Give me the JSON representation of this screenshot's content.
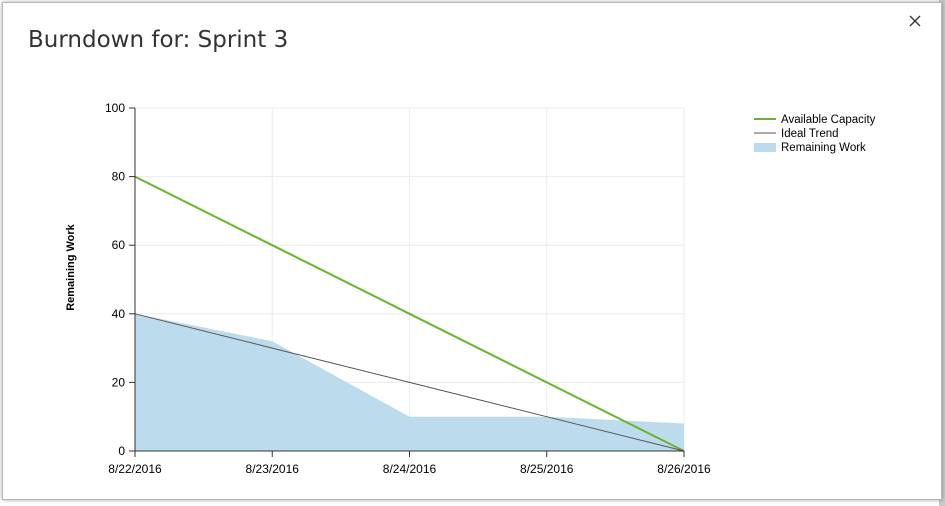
{
  "dialog": {
    "title": "Burndown for: Sprint 3",
    "close_icon": "close-icon"
  },
  "chart_data": {
    "type": "line",
    "title": "",
    "xlabel": "",
    "ylabel": "Remaining Work",
    "x": [
      "8/22/2016",
      "8/23/2016",
      "8/24/2016",
      "8/25/2016",
      "8/26/2016"
    ],
    "ylim": [
      0,
      100
    ],
    "yticks": [
      0,
      20,
      40,
      60,
      80,
      100
    ],
    "grid": true,
    "legend_position": "top-right",
    "series": [
      {
        "name": "Available Capacity",
        "kind": "line",
        "color": "#6bb32e",
        "values": [
          80,
          60,
          40,
          20,
          0
        ]
      },
      {
        "name": "Ideal Trend",
        "kind": "line",
        "color": "#555555",
        "values": [
          40,
          30,
          20,
          10,
          0
        ]
      },
      {
        "name": "Remaining Work",
        "kind": "area",
        "color": "#bcdcee",
        "values": [
          40,
          32,
          10,
          10,
          8
        ]
      }
    ]
  }
}
